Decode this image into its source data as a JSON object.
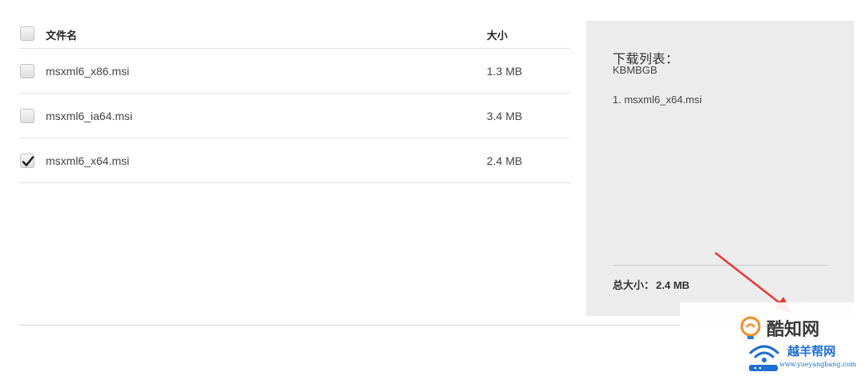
{
  "table": {
    "header": {
      "name": "文件名",
      "size": "大小"
    },
    "files": [
      {
        "name": "msxml6_x86.msi",
        "size": "1.3 MB",
        "checked": false
      },
      {
        "name": "msxml6_ia64.msi",
        "size": "3.4 MB",
        "checked": false
      },
      {
        "name": "msxml6_x64.msi",
        "size": "2.4 MB",
        "checked": true
      }
    ]
  },
  "download_list": {
    "title": "下载列表：",
    "subtitle": "KBMBGB",
    "items": [
      "1. msxml6_x64.msi"
    ],
    "total_label": "总大小：",
    "total_value": "2.4 MB"
  },
  "overlay": {
    "arrow_color": "#e53935",
    "watermark_1": "酷知网",
    "watermark_2": "越羊帮网",
    "watermark_2_url": "www.yueyangbang.com"
  },
  "icons": {
    "checkbox_checked": "checkmark-icon",
    "watermark_1_logo": "lightbulb-icon",
    "watermark_2_logo": "wifi-icon"
  }
}
